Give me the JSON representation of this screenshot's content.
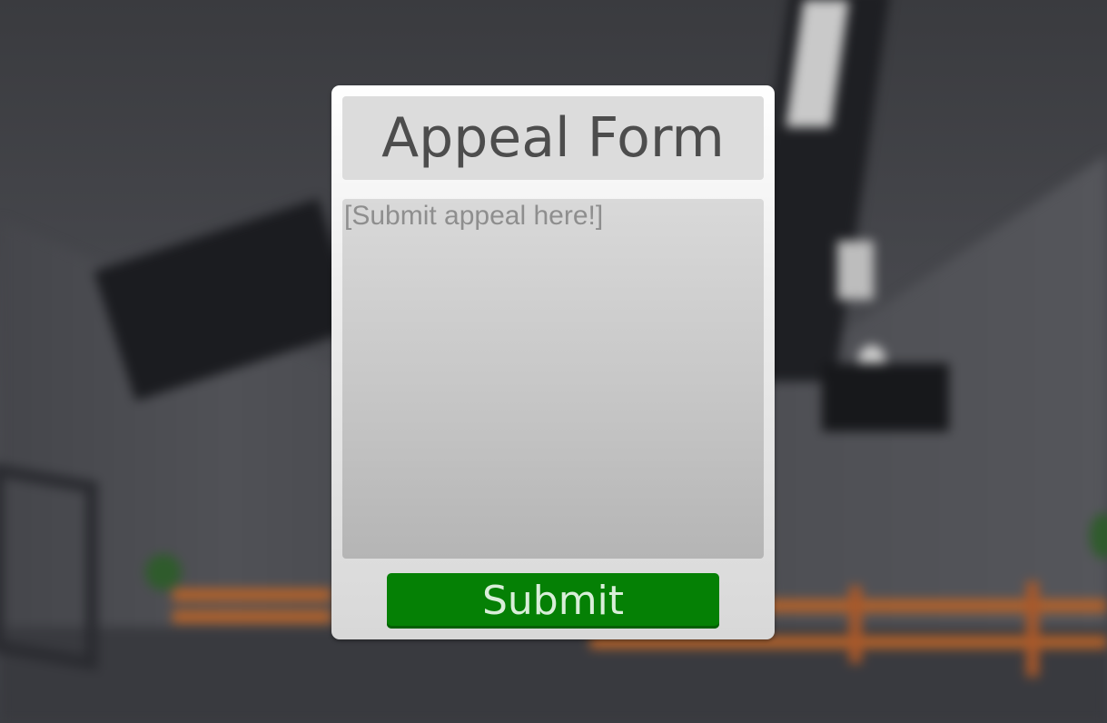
{
  "form": {
    "title": "Appeal Form",
    "appeal_placeholder": "[Submit appeal here!]",
    "appeal_value": "",
    "submit_label": "Submit"
  },
  "colors": {
    "submit_button": "#058005",
    "panel": "#e8e8e8",
    "title_text": "#4d4d4d"
  }
}
